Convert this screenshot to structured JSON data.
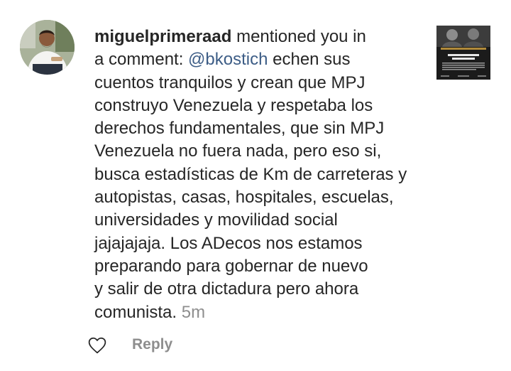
{
  "notification": {
    "username": "miguelprimeraad",
    "action_text": " mentioned you in",
    "line2_prefix": "a comment: ",
    "mention": "@bkostich",
    "line2_suffix": " echen sus",
    "lines": [
      "cuentos tranquilos y crean que MPJ",
      "construyo Venezuela y respetaba los",
      "derechos fundamentales, que sin MPJ",
      "Venezuela no fuera nada, pero eso si,",
      "busca estadísticas de Km de carreteras y",
      "autopistas, casas, hospitales, escuelas,",
      "universidades y movilidad social",
      "jajajajaja. Los ADecos nos estamos",
      "preparando para gobernar de nuevo",
      "y salir de otra dictadura pero ahora"
    ],
    "last_line": "comunista.",
    "timestamp": "5m"
  },
  "post_thumbnail": {
    "headline": "¿Qué pasó con el juicio a Pérez Jiménez?"
  },
  "actions": {
    "like_icon": "heart-outline-icon",
    "reply_label": "Reply"
  },
  "colors": {
    "text": "#262626",
    "mention": "#3d5d86",
    "secondary": "#8e8e8e"
  }
}
